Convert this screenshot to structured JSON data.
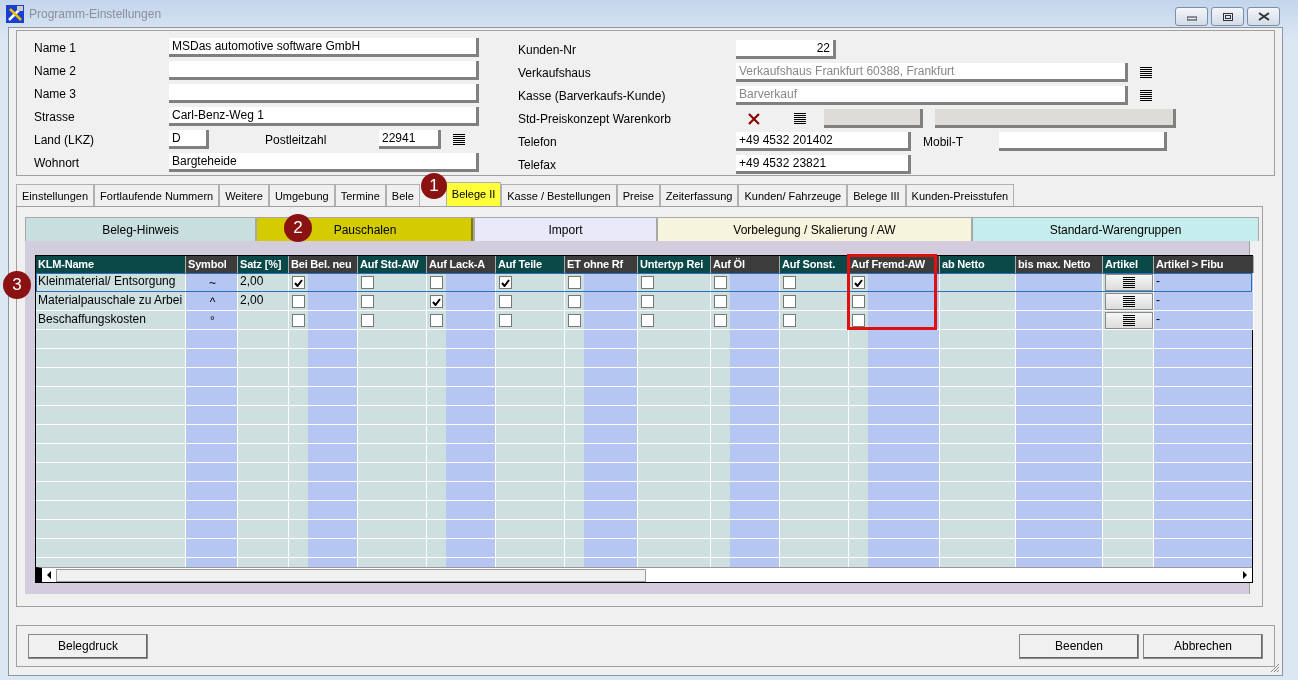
{
  "window": {
    "title": "Programm-Einstellungen"
  },
  "address": {
    "left": [
      {
        "label": "Name 1",
        "value": "MSDas automotive software GmbH"
      },
      {
        "label": "Name 2"
      },
      {
        "label": "Name 3"
      },
      {
        "label": "Strasse",
        "value": "Carl-Benz-Weg 1"
      },
      {
        "label": "Land (LKZ)",
        "value": "D",
        "extra_label": "Postleitzahl",
        "extra_value": "22941"
      },
      {
        "label": "Wohnort",
        "value": "Bargteheide"
      }
    ],
    "right": [
      {
        "kind": "number",
        "label": "Kunden-Nr",
        "value": "22"
      },
      {
        "kind": "picker",
        "label": "Verkaufshaus",
        "value": "Verkaufshaus Frankfurt 60388, Frankfurt",
        "disabled": true
      },
      {
        "kind": "picker",
        "label": "Kasse (Barverkaufs-Kunde)",
        "value": "Barverkauf",
        "disabled": true
      },
      {
        "kind": "concept",
        "label": "Std-Preiskonzept Warenkorb"
      },
      {
        "kind": "phone",
        "label": "Telefon",
        "value": "+49 4532 201402",
        "extra_label": "Mobil-T"
      },
      {
        "kind": "short",
        "label": "Telefax",
        "value": "+49 4532 23821"
      }
    ]
  },
  "tabs": [
    {
      "label": "Einstellungen",
      "selected": false
    },
    {
      "label": "Fortlaufende Nummern",
      "selected": false
    },
    {
      "label": "Weitere",
      "selected": false
    },
    {
      "label": "Umgebung",
      "selected": false
    },
    {
      "label": "Termine",
      "selected": false
    },
    {
      "label": "Bele",
      "selected": false,
      "marker": "1"
    },
    {
      "label": "Belege II",
      "selected": true
    },
    {
      "label": "Kasse / Bestellungen",
      "selected": false
    },
    {
      "label": "Preise",
      "selected": false
    },
    {
      "label": "Zeiterfassung",
      "selected": false
    },
    {
      "label": "Kunden/ Fahrzeuge",
      "selected": false
    },
    {
      "label": "Belege III",
      "selected": false
    },
    {
      "label": "Kunden-Preisstufen",
      "selected": false
    }
  ],
  "subtabs": [
    {
      "label": "Beleg-Hinweis",
      "selected": false,
      "color": "#c9dede"
    },
    {
      "label": "Pauschalen",
      "selected": true,
      "color": "#d4cc00",
      "marker": "2"
    },
    {
      "label": "Import",
      "selected": false,
      "color": "#e9e9fa"
    },
    {
      "label": "Vorbelegung / Skalierung / AW",
      "selected": false,
      "color": "#f6f4dc"
    },
    {
      "label": "Standard-Warengruppen",
      "selected": false,
      "color": "#c6eded"
    }
  ],
  "table": {
    "columns": [
      {
        "label": "KLM-Name",
        "kind": "text"
      },
      {
        "label": "Symbol",
        "kind": "center"
      },
      {
        "label": "Satz [%]",
        "kind": "text"
      },
      {
        "label": "Bei Bel. neu",
        "kind": "check"
      },
      {
        "label": "Auf Std-AW",
        "kind": "check"
      },
      {
        "label": "Auf Lack-A",
        "kind": "check"
      },
      {
        "label": "Auf Teile",
        "kind": "check"
      },
      {
        "label": "ET ohne Rf",
        "kind": "check"
      },
      {
        "label": "Untertyp Rei",
        "kind": "check"
      },
      {
        "label": "Auf Öl",
        "kind": "check"
      },
      {
        "label": "Auf Sonst.",
        "kind": "check"
      },
      {
        "label": "Auf Fremd-AW",
        "kind": "check",
        "highlighted": true
      },
      {
        "label": "ab Netto",
        "kind": "text"
      },
      {
        "label": "bis max. Netto",
        "kind": "text"
      },
      {
        "label": "Artikel",
        "kind": "button"
      },
      {
        "label": "Artikel > Fibu",
        "kind": "text"
      }
    ],
    "rows": [
      {
        "selected": true,
        "marker": "3",
        "cells": [
          {
            "text": "Kleinmaterial/ Entsorgung"
          },
          {
            "text": "~"
          },
          {
            "text": "2,00"
          },
          {
            "checked": true
          },
          {
            "checked": false
          },
          {
            "checked": false
          },
          {
            "checked": true
          },
          {
            "checked": false
          },
          {
            "checked": false
          },
          {
            "checked": false
          },
          {
            "checked": false
          },
          {
            "checked": true
          },
          {},
          {},
          {},
          {
            "text": "-"
          }
        ]
      },
      {
        "selected": false,
        "cells": [
          {
            "text": "Materialpauschale zu Arbei"
          },
          {
            "text": "^"
          },
          {
            "text": "2,00"
          },
          {
            "checked": false
          },
          {
            "checked": false
          },
          {
            "checked": true
          },
          {
            "checked": false
          },
          {
            "checked": false
          },
          {
            "checked": false
          },
          {
            "checked": false
          },
          {
            "checked": false
          },
          {
            "checked": false
          },
          {},
          {},
          {},
          {
            "text": "-"
          }
        ]
      },
      {
        "selected": false,
        "cells": [
          {
            "text": "Beschaffungskosten"
          },
          {
            "text": "°"
          },
          {},
          {
            "checked": false
          },
          {
            "checked": false
          },
          {
            "checked": false
          },
          {
            "checked": false
          },
          {
            "checked": false
          },
          {
            "checked": false
          },
          {
            "checked": false
          },
          {
            "checked": false
          },
          {
            "checked": false
          },
          {},
          {},
          {},
          {
            "text": "-"
          }
        ]
      }
    ]
  },
  "buttons_left": [
    "Belegdruck"
  ],
  "buttons_right": [
    "Beenden",
    "Abbrechen"
  ]
}
